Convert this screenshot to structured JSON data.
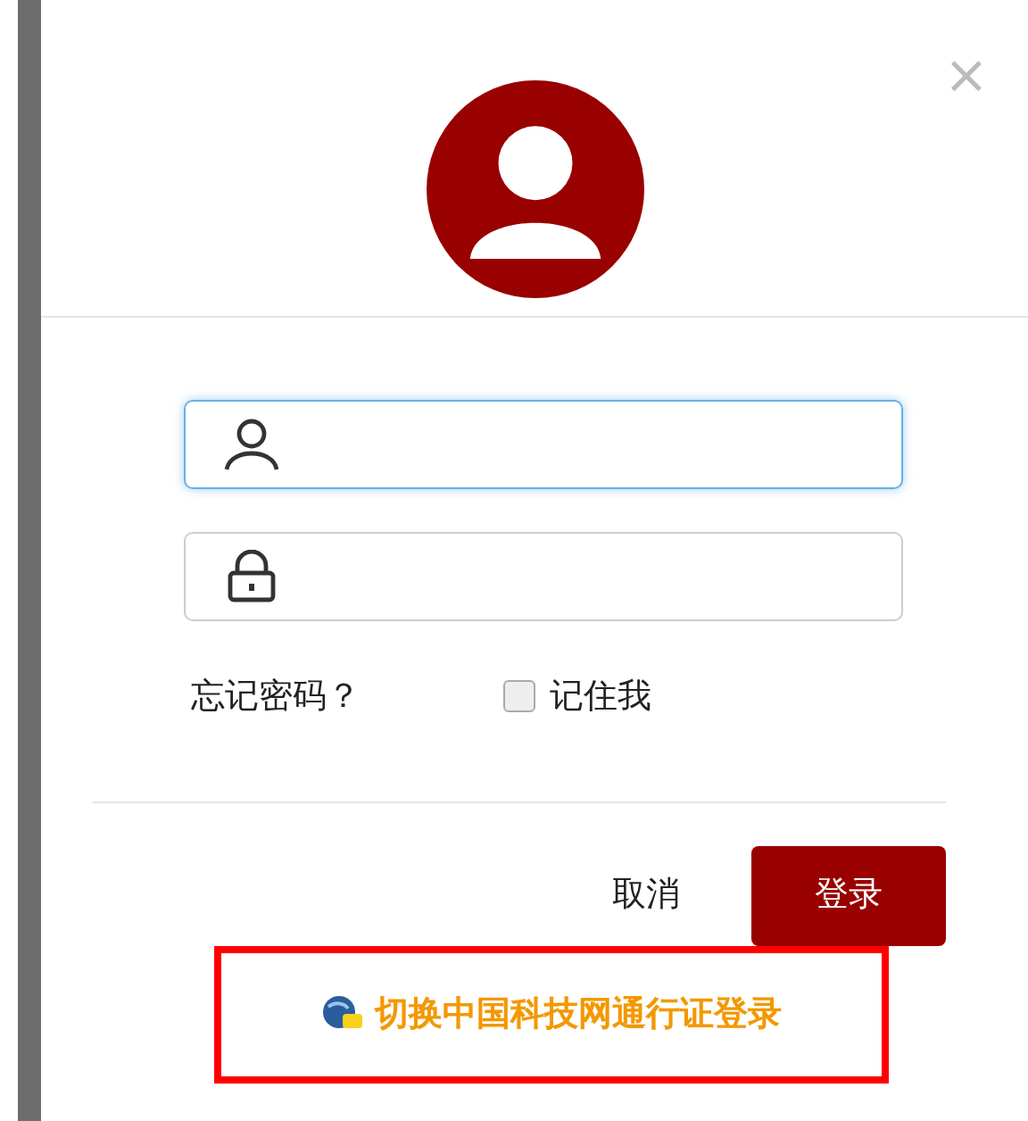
{
  "dialog": {
    "close": "×",
    "fields": [
      {
        "kind": "user",
        "focused": true
      },
      {
        "kind": "lock",
        "focused": false
      }
    ],
    "forgot_password": "忘记密码？",
    "remember_me": {
      "label": "记住我",
      "checked": false
    },
    "buttons": [
      {
        "label": "取消",
        "kind": "plain"
      },
      {
        "label": "登录",
        "kind": "primary"
      }
    ],
    "switch_login": {
      "label": "切换中国科技网通行证登录",
      "highlighted": true
    }
  }
}
